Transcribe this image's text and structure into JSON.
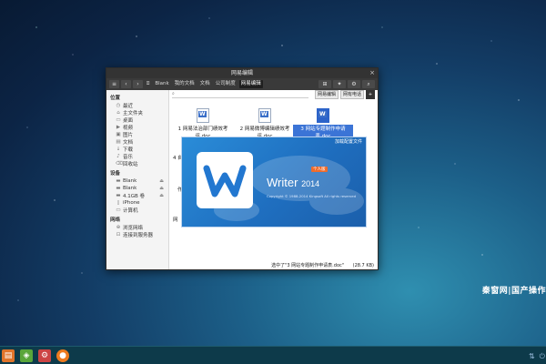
{
  "desktop": {
    "brand_text": "秦窗网|国产操作"
  },
  "window": {
    "title": "网易编辑",
    "breadcrumbs": [
      "Blank",
      "我的文档",
      "文档",
      "公司制度",
      "网易编辑"
    ],
    "sidebar": {
      "places_header": "位置",
      "places": [
        {
          "label": "最近",
          "icon": "clock-icon"
        },
        {
          "label": "主文件夹",
          "icon": "home-icon"
        },
        {
          "label": "桌面",
          "icon": "desktop-icon"
        },
        {
          "label": "视频",
          "icon": "video-icon"
        },
        {
          "label": "图片",
          "icon": "image-icon"
        },
        {
          "label": "文档",
          "icon": "document-icon"
        },
        {
          "label": "下载",
          "icon": "download-icon"
        },
        {
          "label": "音乐",
          "icon": "music-icon"
        },
        {
          "label": "回收站",
          "icon": "trash-icon"
        }
      ],
      "devices_header": "设备",
      "devices": [
        {
          "label": "Blank",
          "icon": "drive-icon"
        },
        {
          "label": "Blank",
          "icon": "drive-icon"
        },
        {
          "label": "4.1GB 卷",
          "icon": "drive-icon"
        },
        {
          "label": "iPhone",
          "icon": "phone-icon"
        },
        {
          "label": "计算机",
          "icon": "computer-icon"
        }
      ],
      "network_header": "网络",
      "network": [
        {
          "label": "浏览网络",
          "icon": "network-icon"
        },
        {
          "label": "连接到服务器",
          "icon": "server-icon"
        }
      ]
    },
    "search_buttons": [
      "网易编辑",
      "网有电话"
    ],
    "files": [
      {
        "name": "1 网易法治部门绩效考评.doc"
      },
      {
        "name": "2 网易微博编辑绩效考评.doc"
      },
      {
        "name": "3 网站专题制作申请表.doc"
      }
    ],
    "partial_labels": [
      "4 自",
      "作",
      "网"
    ],
    "status": {
      "text": "选中了\"3 网站专题制作申请表.doc\"",
      "size": "(28.7 KB)"
    }
  },
  "splash": {
    "top_link": "加载配置文件",
    "app_name": "Writer",
    "version": "2014",
    "edition": "个人版",
    "copyright": "Copyright © 1988-2014 Kingsoft All rights reserved"
  },
  "taskbar": {
    "apps": [
      {
        "icon": "folder-icon",
        "color": "#e0742a"
      },
      {
        "icon": "store-icon",
        "color": "#5aa63a"
      },
      {
        "icon": "settings-icon",
        "color": "#cc4444"
      },
      {
        "icon": "firefox-icon",
        "color": "#ee7a1e"
      }
    ]
  }
}
